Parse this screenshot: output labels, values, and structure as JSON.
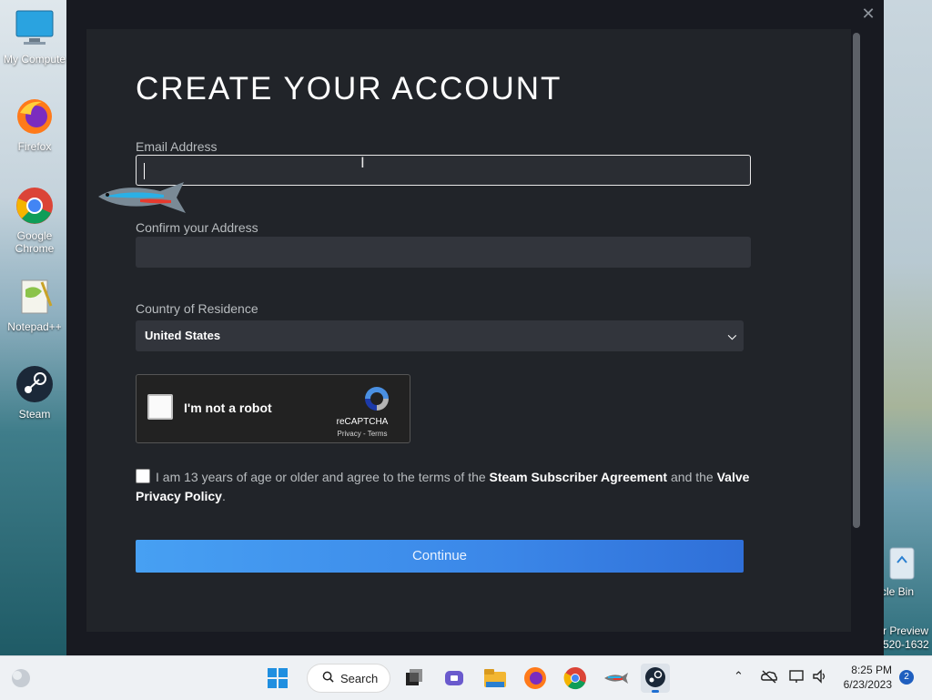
{
  "desktop": {
    "icons": [
      {
        "label": "My Compute"
      },
      {
        "label": "Firefox"
      },
      {
        "label": "Google Chrome"
      },
      {
        "label": "Notepad++"
      },
      {
        "label": "Steam"
      }
    ],
    "right_icons": {
      "recycle_bin": "cle Bin",
      "watermark_line1": "r Preview",
      "watermark_line2": "520-1632"
    }
  },
  "dialog": {
    "close_glyph": "✕",
    "title": "CREATE YOUR ACCOUNT",
    "email_label": "Email Address",
    "email_value": "",
    "confirm_label": "Confirm your Address",
    "confirm_value": "",
    "country_label": "Country of Residence",
    "country_selected": "United States",
    "captcha": {
      "text": "I'm not a robot",
      "brand": "reCAPTCHA",
      "links": "Privacy - Terms"
    },
    "agree": {
      "prefix": "I am 13 years of age or older and agree to the terms of the",
      "ssa_link": "Steam Subscriber Agreement",
      "middle": "and the",
      "privacy_link": "Valve Privacy Policy",
      "suffix": "."
    },
    "continue_label": "Continue"
  },
  "taskbar": {
    "search_label": "Search",
    "time": "8:25 PM",
    "date": "6/23/2023",
    "notification_count": "2"
  },
  "colors": {
    "accent": "#3b87e8",
    "dialog_bg": "#181a21",
    "panel_bg": "#212429"
  }
}
